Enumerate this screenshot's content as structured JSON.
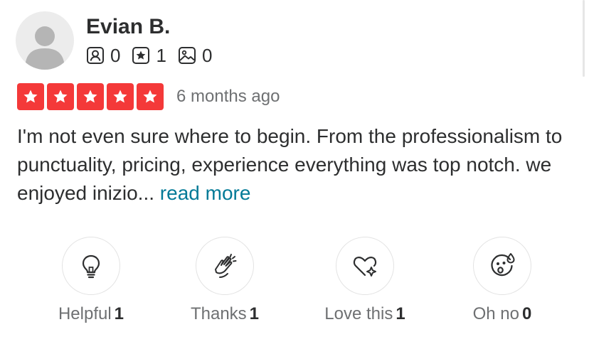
{
  "reviewer": {
    "name": "Evian B.",
    "avatar_icon": "default-user-avatar-icon",
    "stats": [
      {
        "icon": "friends-icon",
        "value": "0"
      },
      {
        "icon": "reviews-icon",
        "value": "1"
      },
      {
        "icon": "photos-icon",
        "value": "0"
      }
    ]
  },
  "rating": {
    "stars": 5,
    "max": 5,
    "star_color": "#f43939",
    "date": "6 months ago"
  },
  "review": {
    "text": "I'm not even sure where to begin. From the professionalism to punctuality, pricing, experience everything was top notch. we enjoyed inizio...",
    "read_more_label": "read more",
    "link_color": "#027a97"
  },
  "reactions": [
    {
      "icon": "lightbulb-icon",
      "label": "Helpful",
      "count": "1"
    },
    {
      "icon": "clapping-hands-icon",
      "label": "Thanks",
      "count": "1"
    },
    {
      "icon": "heart-sparkle-icon",
      "label": "Love this",
      "count": "1"
    },
    {
      "icon": "surprised-face-icon",
      "label": "Oh no",
      "count": "0"
    }
  ]
}
